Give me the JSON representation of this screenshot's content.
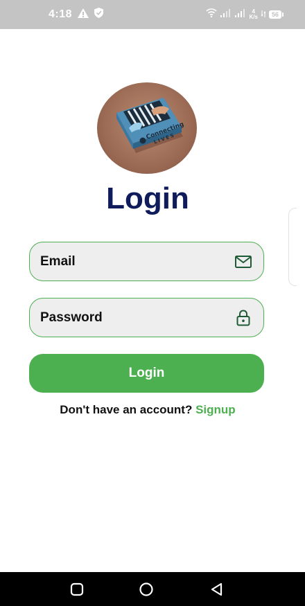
{
  "status_bar": {
    "time": "4:18",
    "speed_value": "4",
    "speed_unit": "K/s",
    "battery": "56",
    "icons": [
      "alert-icon",
      "shield-icon",
      "wifi-icon",
      "signal-icon",
      "signal-icon"
    ]
  },
  "logo": {
    "text_line1": "Connecting",
    "text_line2": "LIVES"
  },
  "page": {
    "title": "Login"
  },
  "form": {
    "email_label": "Email",
    "email_icon": "mail-icon",
    "password_label": "Password",
    "password_icon": "lock-icon",
    "login_button": "Login"
  },
  "signup": {
    "prompt": "Don't have an account?",
    "link": "Signup"
  },
  "nav": {
    "icons": [
      "recents-icon",
      "home-icon",
      "back-icon"
    ]
  },
  "colors": {
    "accent": "#4caf50",
    "title": "#0f1b5a",
    "field_bg": "#eeeeee",
    "status_bar": "#c4c4c4"
  }
}
